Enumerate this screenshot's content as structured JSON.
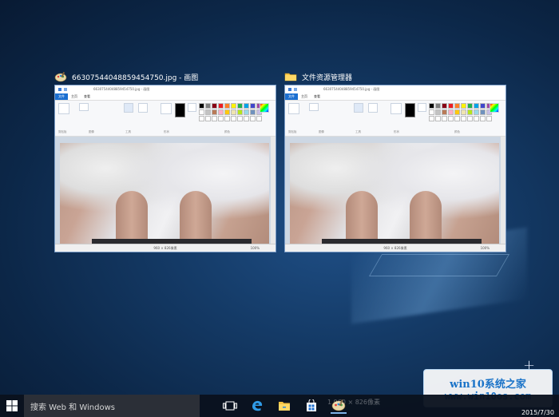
{
  "task_view": {
    "windows": [
      {
        "title": "66307544048859454750.jpg - 画图",
        "window_caption": "66307544048859454750.jpg - 画图",
        "menu": {
          "file": "文件",
          "home": "主页",
          "view": "查看"
        },
        "ribbon_groups": [
          "剪贴板",
          "图像",
          "工具",
          "形状",
          "颜色"
        ],
        "ribbon_buttons": {
          "paste": "粘贴",
          "select": "选择",
          "brush": "刷子",
          "shapes": "形状",
          "size": "粗细",
          "color1": "颜色 1",
          "color2": "颜色 2",
          "edit_colors": "编辑颜色"
        },
        "status": {
          "dimensions": "960 × 826像素",
          "zoom": "100%"
        }
      },
      {
        "title": "文件资源管理器",
        "window_caption": "66307544048859454750.jpg - 画图",
        "menu": {
          "file": "文件",
          "home": "主页",
          "view": "查看"
        },
        "ribbon_groups": [
          "剪贴板",
          "图像",
          "工具",
          "形状",
          "颜色"
        ],
        "ribbon_buttons": {
          "paste": "粘贴",
          "select": "选择",
          "brush": "刷子",
          "shapes": "形状",
          "size": "粗细",
          "color1": "颜色 1",
          "color2": "颜色 2",
          "edit_colors": "编辑颜色"
        },
        "status": {
          "dimensions": "960 × 826像素",
          "zoom": "100%"
        }
      }
    ],
    "new_desktop": "+"
  },
  "palette_colors": [
    "#000000",
    "#7f7f7f",
    "#880015",
    "#ed1c24",
    "#ff7f27",
    "#fff200",
    "#22b14c",
    "#00a2e8",
    "#3f48cc",
    "#a349a4",
    "#ffffff",
    "#c3c3c3",
    "#b97a57",
    "#ffaec9",
    "#ffc90e",
    "#efe4b0",
    "#b5e61d",
    "#99d9ea",
    "#7092be",
    "#c8bfe7",
    "#ffffff",
    "#ffffff",
    "#ffffff",
    "#ffffff",
    "#ffffff",
    "#ffffff",
    "#ffffff",
    "#ffffff",
    "#ffffff",
    "#ffffff"
  ],
  "watermark": {
    "line1": "win10系统之家",
    "line2": "www.win10os.com"
  },
  "taskbar": {
    "search_placeholder": "搜索 Web 和 Windows",
    "ghost_text": "1 960 × 826像素",
    "date": "2015/7/30",
    "icons": [
      "task-view-icon",
      "edge-icon",
      "file-explorer-icon",
      "store-icon",
      "paint-icon"
    ]
  }
}
